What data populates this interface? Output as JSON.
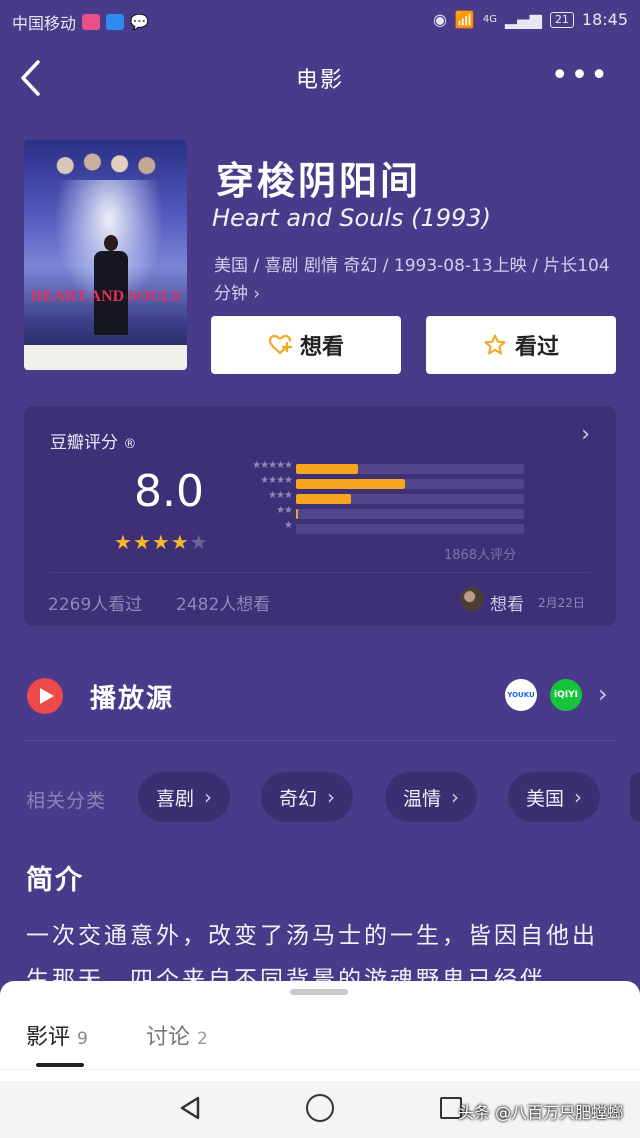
{
  "status_bar": {
    "carrier": "中国移动",
    "network": "4G",
    "battery": "21",
    "time": "18:45"
  },
  "nav": {
    "back_icon": "chevron-left-icon",
    "title": "电影",
    "more_icon": "more-dots-icon"
  },
  "movie": {
    "poster_title": "HEART AND SOULS",
    "title": "穿梭阴阳间",
    "original_title": "Heart and Souls (1993)",
    "meta": "美国 / 喜剧 剧情 奇幻 / 1993-08-13上映 / 片长104 分钟 ›"
  },
  "actions": {
    "want_label": "想看",
    "seen_label": "看过"
  },
  "rating": {
    "label": "豆瓣评分",
    "score": "8.0",
    "stars_filled": 4,
    "stars_total": 5,
    "distribution": [
      {
        "stars": 5,
        "percent": 27
      },
      {
        "stars": 4,
        "percent": 48
      },
      {
        "stars": 3,
        "percent": 24
      },
      {
        "stars": 2,
        "percent": 1
      },
      {
        "stars": 1,
        "percent": 0
      }
    ],
    "count_text": "1868人评分",
    "seen_text": "2269人看过",
    "want_text": "2482人想看",
    "friend_action": "想看",
    "friend_date": "2月22日",
    "bar_color": "#f7a41e",
    "star_color": "#f7b52c"
  },
  "play_source": {
    "label": "播放源",
    "providers": [
      "YOUKU",
      "iQIYI"
    ]
  },
  "categories": {
    "label": "相关分类",
    "items": [
      "喜剧",
      "奇幻",
      "温情",
      "美国"
    ]
  },
  "intro": {
    "heading": "简介",
    "text": "一次交通意外，改变了汤马士的一生，皆因自他出生那天，四个来自不同背景的游魂野鬼已经伴"
  },
  "sheet": {
    "tabs": [
      {
        "label": "影评",
        "count": "9"
      },
      {
        "label": "讨论",
        "count": "2"
      }
    ]
  },
  "system_nav": {
    "watermark": "头条 @八百万只肥螳螂"
  },
  "colors": {
    "background": "#4a3b8a",
    "card": "#3d3076",
    "accent_red": "#ef4a4a"
  }
}
